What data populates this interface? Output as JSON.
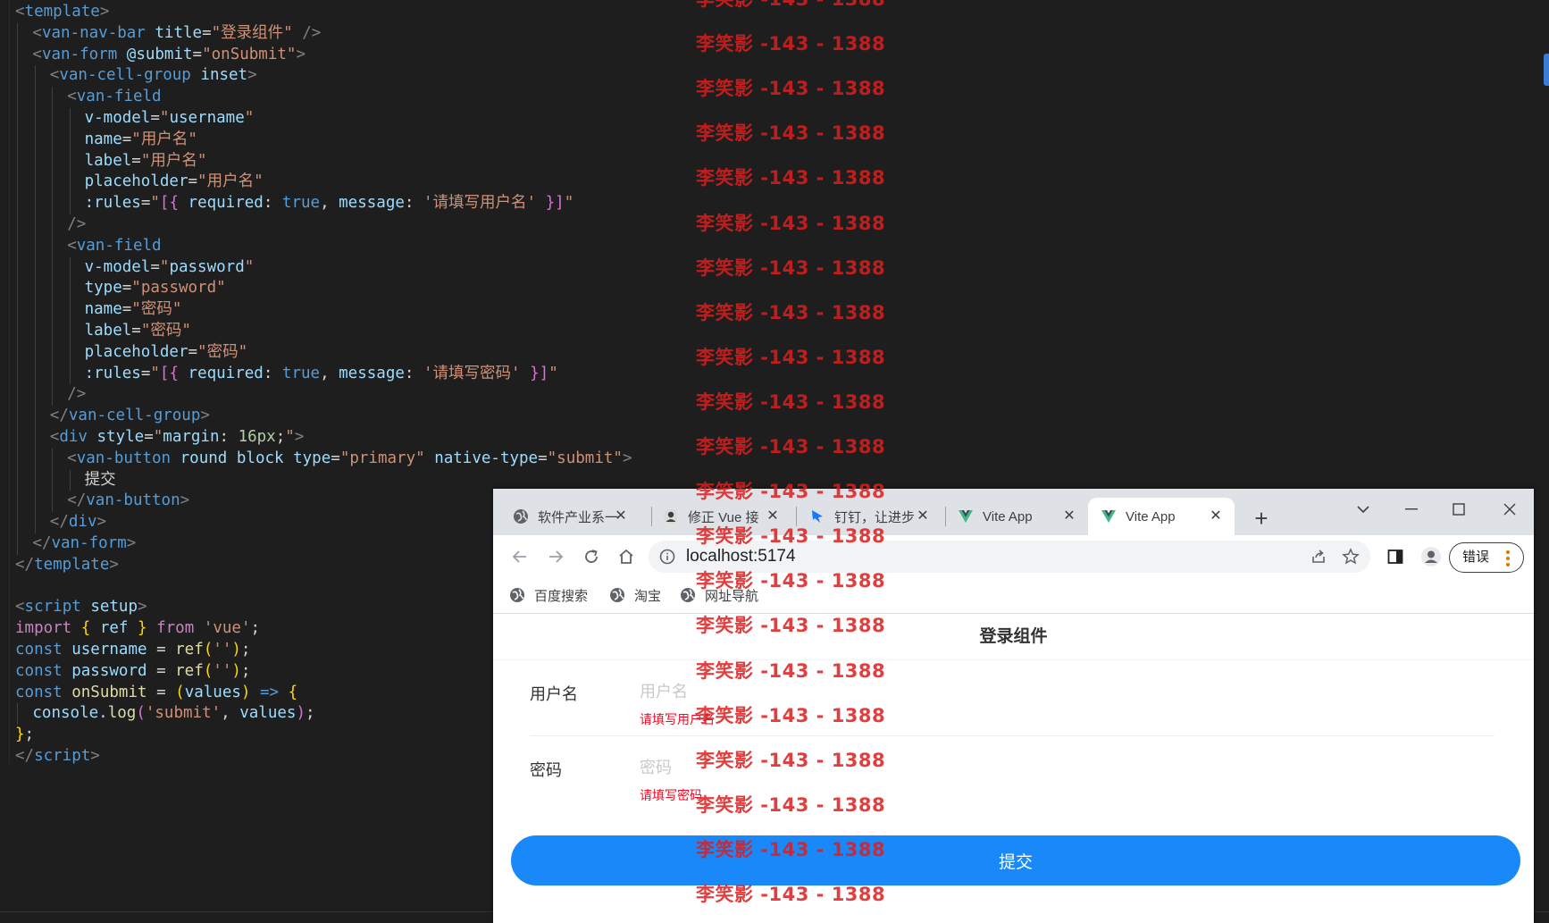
{
  "editor": {
    "lines": [
      {
        "indent": 0,
        "tokens": [
          [
            "t-p",
            "<"
          ],
          [
            "t-tag",
            "template"
          ],
          [
            "t-p",
            ">"
          ]
        ]
      },
      {
        "indent": 1,
        "tokens": [
          [
            "t-p",
            "<"
          ],
          [
            "t-tag",
            "van-nav-bar"
          ],
          [
            "t-text",
            " "
          ],
          [
            "t-attr",
            "title"
          ],
          [
            "t-text",
            "="
          ],
          [
            "t-str",
            "\"登录组件\""
          ],
          [
            "t-text",
            " "
          ],
          [
            "t-p",
            "/>"
          ]
        ]
      },
      {
        "indent": 1,
        "tokens": [
          [
            "t-p",
            "<"
          ],
          [
            "t-tag",
            "van-form"
          ],
          [
            "t-text",
            " "
          ],
          [
            "t-attr",
            "@submit"
          ],
          [
            "t-text",
            "="
          ],
          [
            "t-str",
            "\"onSubmit\""
          ],
          [
            "t-p",
            ">"
          ]
        ]
      },
      {
        "indent": 2,
        "tokens": [
          [
            "t-p",
            "<"
          ],
          [
            "t-tag",
            "van-cell-group"
          ],
          [
            "t-text",
            " "
          ],
          [
            "t-attr",
            "inset"
          ],
          [
            "t-p",
            ">"
          ]
        ]
      },
      {
        "indent": 3,
        "tokens": [
          [
            "t-p",
            "<"
          ],
          [
            "t-tag",
            "van-field"
          ]
        ]
      },
      {
        "indent": 4,
        "tokens": [
          [
            "t-attr",
            "v-model"
          ],
          [
            "t-text",
            "="
          ],
          [
            "t-str",
            "\""
          ],
          [
            "t-var",
            "username"
          ],
          [
            "t-str",
            "\""
          ]
        ]
      },
      {
        "indent": 4,
        "tokens": [
          [
            "t-attr",
            "name"
          ],
          [
            "t-text",
            "="
          ],
          [
            "t-str",
            "\"用户名\""
          ]
        ]
      },
      {
        "indent": 4,
        "tokens": [
          [
            "t-attr",
            "label"
          ],
          [
            "t-text",
            "="
          ],
          [
            "t-str",
            "\"用户名\""
          ]
        ]
      },
      {
        "indent": 4,
        "tokens": [
          [
            "t-attr",
            "placeholder"
          ],
          [
            "t-text",
            "="
          ],
          [
            "t-str",
            "\"用户名\""
          ]
        ]
      },
      {
        "indent": 4,
        "tokens": [
          [
            "t-attr",
            ":rules"
          ],
          [
            "t-text",
            "="
          ],
          [
            "t-str",
            "\""
          ],
          [
            "t-br",
            "[{"
          ],
          [
            "t-text",
            " "
          ],
          [
            "t-var",
            "required"
          ],
          [
            "t-text",
            ": "
          ],
          [
            "t-kw",
            "true"
          ],
          [
            "t-text",
            ", "
          ],
          [
            "t-var",
            "message"
          ],
          [
            "t-text",
            ": "
          ],
          [
            "t-str",
            "'请填写用户名'"
          ],
          [
            "t-text",
            " "
          ],
          [
            "t-br",
            "}]"
          ],
          [
            "t-str",
            "\""
          ]
        ]
      },
      {
        "indent": 3,
        "tokens": [
          [
            "t-p",
            "/>"
          ]
        ]
      },
      {
        "indent": 3,
        "tokens": [
          [
            "t-p",
            "<"
          ],
          [
            "t-tag",
            "van-field"
          ]
        ]
      },
      {
        "indent": 4,
        "tokens": [
          [
            "t-attr",
            "v-model"
          ],
          [
            "t-text",
            "="
          ],
          [
            "t-str",
            "\""
          ],
          [
            "t-var",
            "password"
          ],
          [
            "t-str",
            "\""
          ]
        ]
      },
      {
        "indent": 4,
        "tokens": [
          [
            "t-attr",
            "type"
          ],
          [
            "t-text",
            "="
          ],
          [
            "t-str",
            "\"password\""
          ]
        ]
      },
      {
        "indent": 4,
        "tokens": [
          [
            "t-attr",
            "name"
          ],
          [
            "t-text",
            "="
          ],
          [
            "t-str",
            "\"密码\""
          ]
        ]
      },
      {
        "indent": 4,
        "tokens": [
          [
            "t-attr",
            "label"
          ],
          [
            "t-text",
            "="
          ],
          [
            "t-str",
            "\"密码\""
          ]
        ]
      },
      {
        "indent": 4,
        "tokens": [
          [
            "t-attr",
            "placeholder"
          ],
          [
            "t-text",
            "="
          ],
          [
            "t-str",
            "\"密码\""
          ]
        ]
      },
      {
        "indent": 4,
        "tokens": [
          [
            "t-attr",
            ":rules"
          ],
          [
            "t-text",
            "="
          ],
          [
            "t-str",
            "\""
          ],
          [
            "t-br",
            "[{"
          ],
          [
            "t-text",
            " "
          ],
          [
            "t-var",
            "required"
          ],
          [
            "t-text",
            ": "
          ],
          [
            "t-kw",
            "true"
          ],
          [
            "t-text",
            ", "
          ],
          [
            "t-var",
            "message"
          ],
          [
            "t-text",
            ": "
          ],
          [
            "t-str",
            "'请填写密码'"
          ],
          [
            "t-text",
            " "
          ],
          [
            "t-br",
            "}]"
          ],
          [
            "t-str",
            "\""
          ]
        ]
      },
      {
        "indent": 3,
        "tokens": [
          [
            "t-p",
            "/>"
          ]
        ]
      },
      {
        "indent": 2,
        "tokens": [
          [
            "t-p",
            "</"
          ],
          [
            "t-tag",
            "van-cell-group"
          ],
          [
            "t-p",
            ">"
          ]
        ]
      },
      {
        "indent": 2,
        "tokens": [
          [
            "t-p",
            "<"
          ],
          [
            "t-tag",
            "div"
          ],
          [
            "t-text",
            " "
          ],
          [
            "t-attr",
            "style"
          ],
          [
            "t-text",
            "="
          ],
          [
            "t-str",
            "\""
          ],
          [
            "t-var",
            "margin"
          ],
          [
            "t-text",
            ": "
          ],
          [
            "t-num",
            "16px"
          ],
          [
            "t-text",
            ";"
          ],
          [
            "t-str",
            "\""
          ],
          [
            "t-p",
            ">"
          ]
        ]
      },
      {
        "indent": 3,
        "tokens": [
          [
            "t-p",
            "<"
          ],
          [
            "t-tag",
            "van-button"
          ],
          [
            "t-text",
            " "
          ],
          [
            "t-attr",
            "round"
          ],
          [
            "t-text",
            " "
          ],
          [
            "t-attr",
            "block"
          ],
          [
            "t-text",
            " "
          ],
          [
            "t-attr",
            "type"
          ],
          [
            "t-text",
            "="
          ],
          [
            "t-str",
            "\"primary\""
          ],
          [
            "t-text",
            " "
          ],
          [
            "t-attr",
            "native-type"
          ],
          [
            "t-text",
            "="
          ],
          [
            "t-str",
            "\"submit\""
          ],
          [
            "t-p",
            ">"
          ]
        ]
      },
      {
        "indent": 4,
        "tokens": [
          [
            "t-text",
            "提交"
          ]
        ]
      },
      {
        "indent": 3,
        "tokens": [
          [
            "t-p",
            "</"
          ],
          [
            "t-tag",
            "van-button"
          ],
          [
            "t-p",
            ">"
          ]
        ]
      },
      {
        "indent": 2,
        "tokens": [
          [
            "t-p",
            "</"
          ],
          [
            "t-tag",
            "div"
          ],
          [
            "t-p",
            ">"
          ]
        ]
      },
      {
        "indent": 1,
        "tokens": [
          [
            "t-p",
            "</"
          ],
          [
            "t-tag",
            "van-form"
          ],
          [
            "t-p",
            ">"
          ]
        ]
      },
      {
        "indent": 0,
        "tokens": [
          [
            "t-p",
            "</"
          ],
          [
            "t-tag",
            "template"
          ],
          [
            "t-p",
            ">"
          ]
        ]
      },
      {
        "indent": 0,
        "tokens": []
      },
      {
        "indent": 0,
        "tokens": [
          [
            "t-p",
            "<"
          ],
          [
            "t-tag",
            "script"
          ],
          [
            "t-text",
            " "
          ],
          [
            "t-attr",
            "setup"
          ],
          [
            "t-p",
            ">"
          ]
        ]
      },
      {
        "indent": 0,
        "tokens": [
          [
            "t-ctrl",
            "import"
          ],
          [
            "t-text",
            " "
          ],
          [
            "t-br2",
            "{"
          ],
          [
            "t-text",
            " "
          ],
          [
            "t-var",
            "ref"
          ],
          [
            "t-text",
            " "
          ],
          [
            "t-br2",
            "}"
          ],
          [
            "t-text",
            " "
          ],
          [
            "t-ctrl",
            "from"
          ],
          [
            "t-text",
            " "
          ],
          [
            "t-str",
            "'vue'"
          ],
          [
            "t-text",
            ";"
          ]
        ]
      },
      {
        "indent": 0,
        "tokens": [
          [
            "t-kw",
            "const"
          ],
          [
            "t-text",
            " "
          ],
          [
            "t-var",
            "username"
          ],
          [
            "t-text",
            " = "
          ],
          [
            "t-func",
            "ref"
          ],
          [
            "t-br2",
            "("
          ],
          [
            "t-str",
            "''"
          ],
          [
            "t-br2",
            ")"
          ],
          [
            "t-text",
            ";"
          ]
        ]
      },
      {
        "indent": 0,
        "tokens": [
          [
            "t-kw",
            "const"
          ],
          [
            "t-text",
            " "
          ],
          [
            "t-var",
            "password"
          ],
          [
            "t-text",
            " = "
          ],
          [
            "t-func",
            "ref"
          ],
          [
            "t-br2",
            "("
          ],
          [
            "t-str",
            "''"
          ],
          [
            "t-br2",
            ")"
          ],
          [
            "t-text",
            ";"
          ]
        ]
      },
      {
        "indent": 0,
        "tokens": [
          [
            "t-kw",
            "const"
          ],
          [
            "t-text",
            " "
          ],
          [
            "t-func",
            "onSubmit"
          ],
          [
            "t-text",
            " = "
          ],
          [
            "t-br2",
            "("
          ],
          [
            "t-var",
            "values"
          ],
          [
            "t-br2",
            ")"
          ],
          [
            "t-text",
            " "
          ],
          [
            "t-kw",
            "=>"
          ],
          [
            "t-text",
            " "
          ],
          [
            "t-br2",
            "{"
          ]
        ]
      },
      {
        "indent": 1,
        "tokens": [
          [
            "t-var",
            "console"
          ],
          [
            "t-text",
            "."
          ],
          [
            "t-func",
            "log"
          ],
          [
            "t-br",
            "("
          ],
          [
            "t-str",
            "'submit'"
          ],
          [
            "t-text",
            ", "
          ],
          [
            "t-var",
            "values"
          ],
          [
            "t-br",
            ")"
          ],
          [
            "t-text",
            ";"
          ]
        ]
      },
      {
        "indent": 0,
        "tokens": [
          [
            "t-br2",
            "}"
          ],
          [
            "t-text",
            ";"
          ]
        ]
      },
      {
        "indent": 0,
        "tokens": [
          [
            "t-p",
            "</"
          ],
          [
            "t-tag",
            "script"
          ],
          [
            "t-p",
            ">"
          ]
        ]
      }
    ]
  },
  "browser": {
    "tabs": [
      {
        "title": "软件产业系一",
        "icon": "globe-icon"
      },
      {
        "title": "修正 Vue 接",
        "icon": "avatar-icon"
      },
      {
        "title": "钉钉，让进步",
        "icon": "dingtalk-icon"
      },
      {
        "title": "Vite App",
        "icon": "vue-icon"
      },
      {
        "title": "Vite App",
        "icon": "vue-icon",
        "active": true
      }
    ],
    "url": "localhost:5174",
    "profile_label": "错误",
    "bookmarks": [
      {
        "label": "百度搜索",
        "icon": "globe-icon"
      },
      {
        "label": "淘宝",
        "icon": "globe-icon"
      },
      {
        "label": "网址导航",
        "icon": "globe-icon"
      }
    ]
  },
  "app": {
    "nav_title": "登录组件",
    "username": {
      "label": "用户名",
      "placeholder": "用户名",
      "error": "请填写用户名",
      "value": ""
    },
    "password": {
      "label": "密码",
      "placeholder": "密码",
      "error": "请填写密码",
      "value": ""
    },
    "submit_label": "提交"
  },
  "watermark": {
    "text": "李笑影 -143 - 1388",
    "color": "#dc1e1e"
  },
  "colors": {
    "primary": "#1989fa",
    "danger": "#ee0a24",
    "editor_bg": "#1e1e1e"
  }
}
